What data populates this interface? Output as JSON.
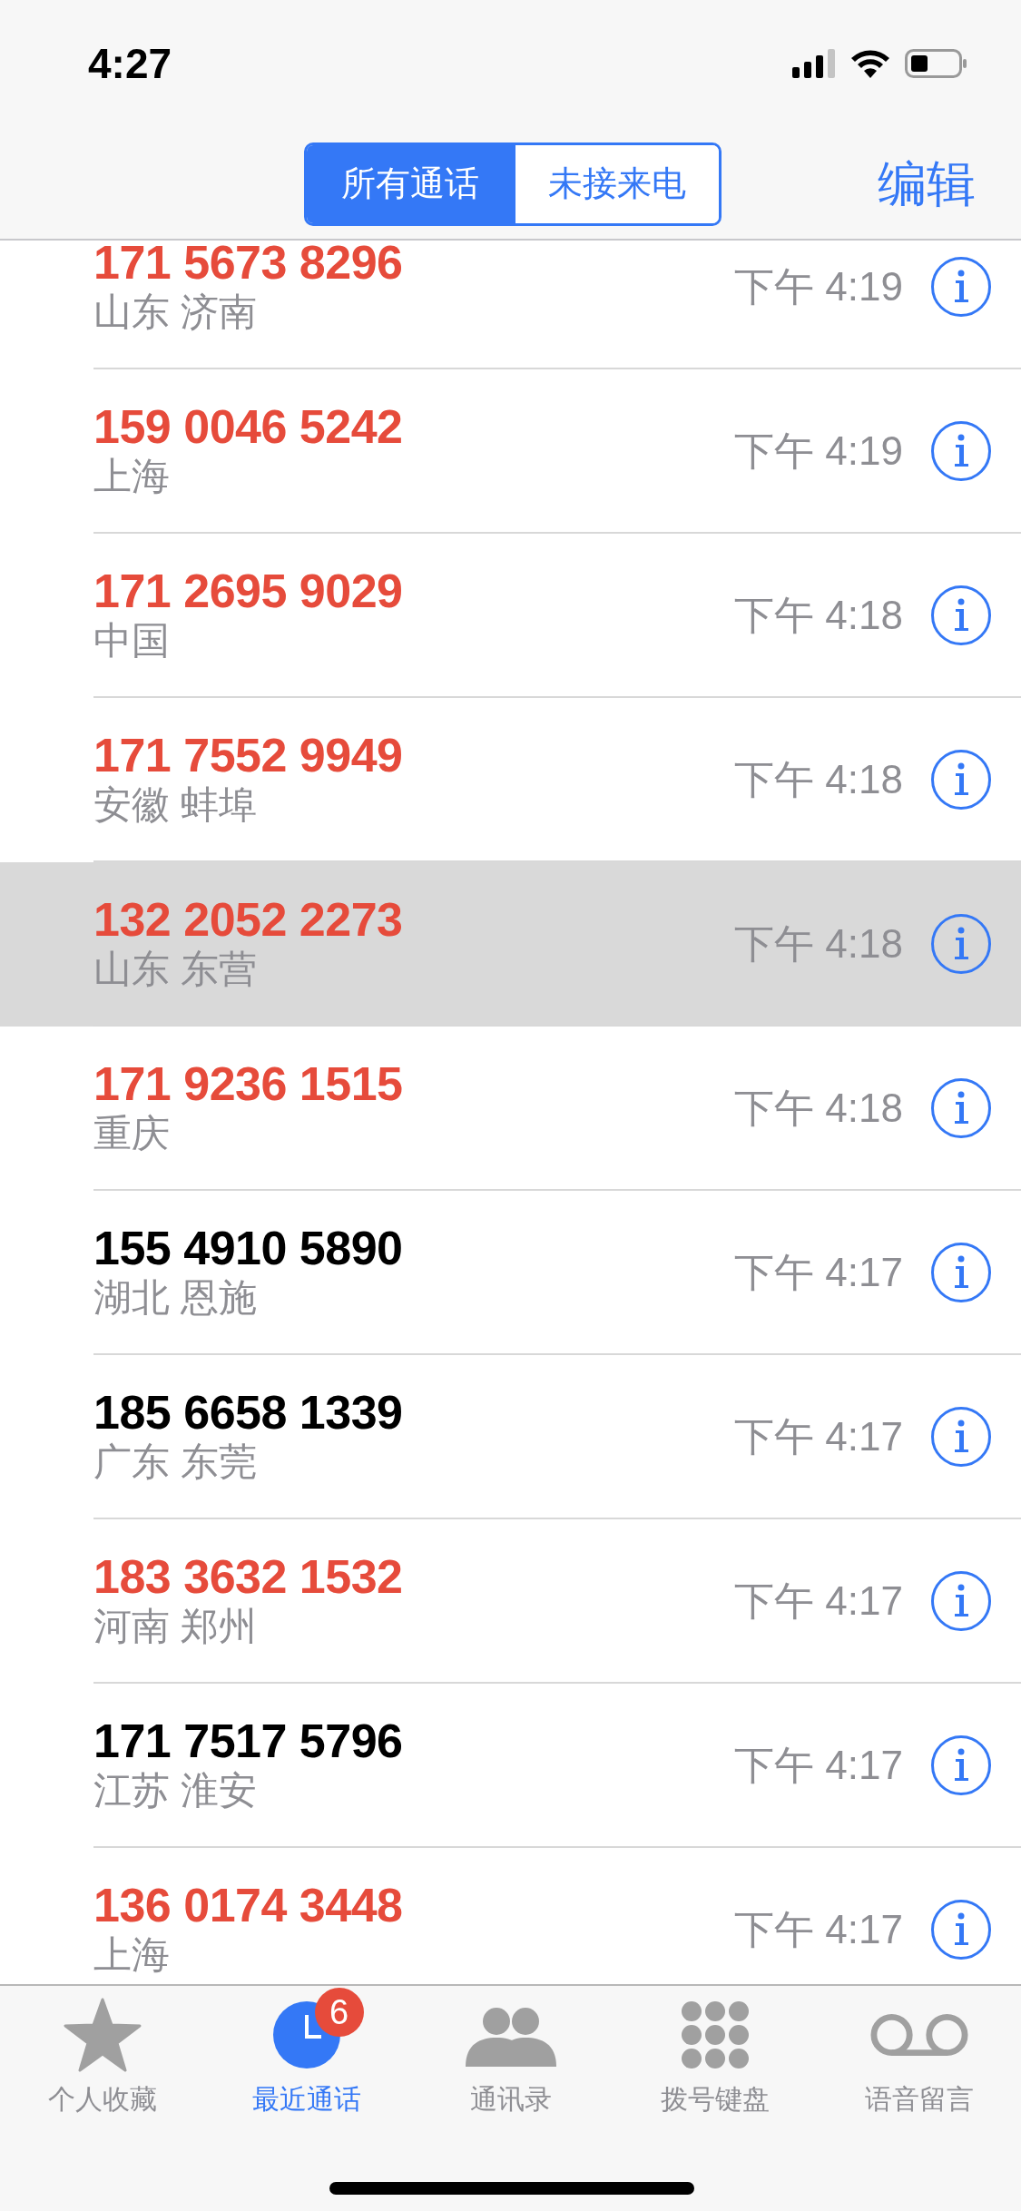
{
  "status_bar": {
    "time": "4:27"
  },
  "segments": [
    {
      "label": "所有通话",
      "selected": true
    },
    {
      "label": "未接来电",
      "selected": false
    }
  ],
  "edit_button": "编辑",
  "calls": [
    {
      "number": "171 5673 8296",
      "location": "山东 济南",
      "time": "下午 4:19",
      "missed": true,
      "selected": false
    },
    {
      "number": "159 0046 5242",
      "location": "上海",
      "time": "下午 4:19",
      "missed": true,
      "selected": false
    },
    {
      "number": "171 2695 9029",
      "location": "中国",
      "time": "下午 4:18",
      "missed": true,
      "selected": false
    },
    {
      "number": "171 7552 9949",
      "location": "安徽 蚌埠",
      "time": "下午 4:18",
      "missed": true,
      "selected": false
    },
    {
      "number": "132 2052 2273",
      "location": "山东 东营",
      "time": "下午 4:18",
      "missed": true,
      "selected": true
    },
    {
      "number": "171 9236 1515",
      "location": "重庆",
      "time": "下午 4:18",
      "missed": true,
      "selected": false
    },
    {
      "number": "155 4910 5890",
      "location": "湖北 恩施",
      "time": "下午 4:17",
      "missed": false,
      "selected": false
    },
    {
      "number": "185 6658 1339",
      "location": "广东 东莞",
      "time": "下午 4:17",
      "missed": false,
      "selected": false
    },
    {
      "number": "183 3632 1532",
      "location": "河南 郑州",
      "time": "下午 4:17",
      "missed": true,
      "selected": false
    },
    {
      "number": "171 7517 5796",
      "location": "江苏 淮安",
      "time": "下午 4:17",
      "missed": false,
      "selected": false
    },
    {
      "number": "136 0174 3448",
      "location": "上海",
      "time": "下午 4:17",
      "missed": true,
      "selected": false
    }
  ],
  "tab_bar": [
    {
      "label": "个人收藏",
      "selected": false
    },
    {
      "label": "最近通话",
      "selected": true,
      "badge": "6"
    },
    {
      "label": "通讯录",
      "selected": false
    },
    {
      "label": "拨号键盘",
      "selected": false
    },
    {
      "label": "语音留言",
      "selected": false
    }
  ]
}
